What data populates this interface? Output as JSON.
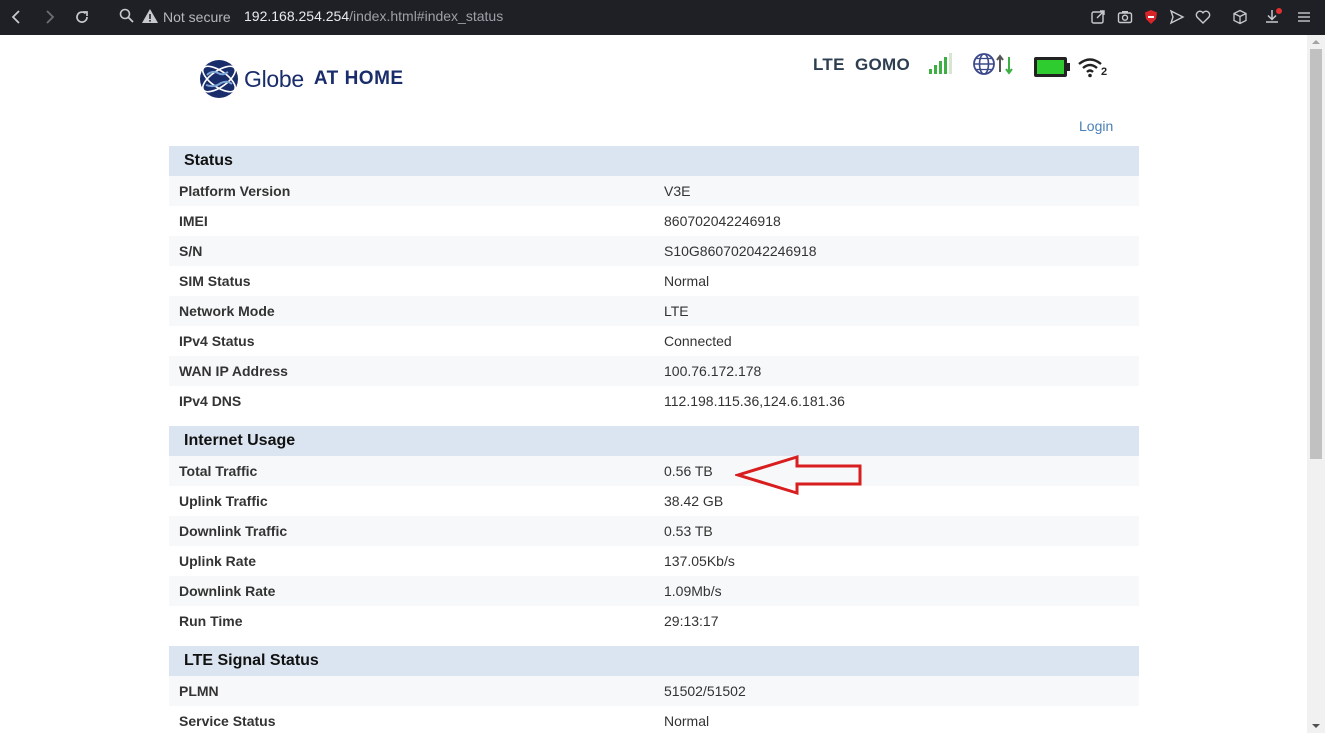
{
  "browser": {
    "security_label": "Not secure",
    "url_host": "192.168.254.254",
    "url_path": "/index.html#index_status"
  },
  "header": {
    "logo_text": "Globe",
    "logo_suffix": "AT HOME",
    "network_type": "LTE",
    "operator": "GOMO",
    "wifi_clients": "2",
    "login_label": "Login"
  },
  "status": {
    "title": "Status",
    "rows": [
      {
        "label": "Platform Version",
        "value": "V3E"
      },
      {
        "label": "IMEI",
        "value": "860702042246918"
      },
      {
        "label": "S/N",
        "value": "S10G860702042246918"
      },
      {
        "label": "SIM Status",
        "value": "Normal"
      },
      {
        "label": "Network Mode",
        "value": "LTE"
      },
      {
        "label": "IPv4 Status",
        "value": "Connected"
      },
      {
        "label": "WAN IP Address",
        "value": "100.76.172.178"
      },
      {
        "label": "IPv4 DNS",
        "value": "112.198.115.36,124.6.181.36"
      }
    ]
  },
  "usage": {
    "title": "Internet Usage",
    "rows": [
      {
        "label": "Total Traffic",
        "value": "0.56 TB"
      },
      {
        "label": "Uplink Traffic",
        "value": "38.42 GB"
      },
      {
        "label": "Downlink Traffic",
        "value": "0.53 TB"
      },
      {
        "label": "Uplink Rate",
        "value": "137.05Kb/s"
      },
      {
        "label": "Downlink Rate",
        "value": "1.09Mb/s"
      },
      {
        "label": "Run Time",
        "value": "29:13:17"
      }
    ]
  },
  "lte": {
    "title": "LTE Signal Status",
    "rows": [
      {
        "label": "PLMN",
        "value": "51502/51502"
      },
      {
        "label": "Service Status",
        "value": "Normal"
      }
    ]
  },
  "colors": {
    "brand_blue": "#1a2d6b",
    "signal_green": "#3cb043",
    "battery_green": "#2ecc2e",
    "section_header_bg": "#dbe5f1",
    "arrow_red": "#d81e1e"
  }
}
